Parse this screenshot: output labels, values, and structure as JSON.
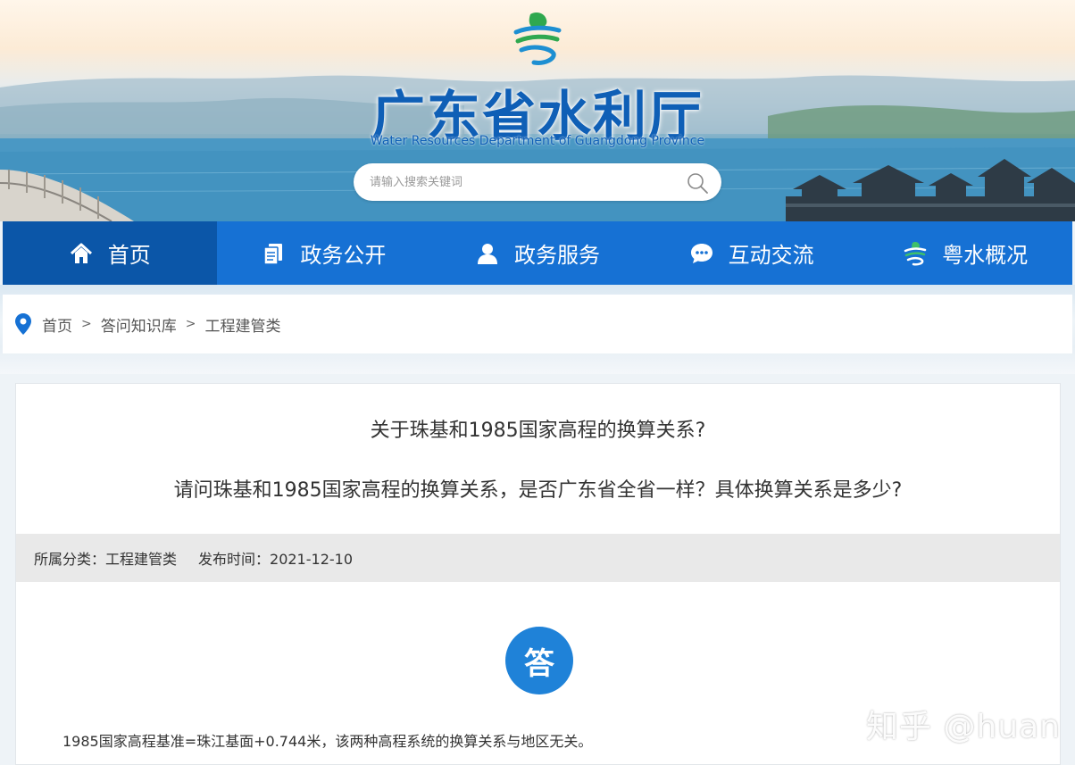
{
  "header": {
    "title": "广东省水利厅",
    "subtitle": "Water Resources Department of Guangdong Province",
    "logo_icon": "yue-emblem-icon",
    "search_placeholder": "请输入搜索关键词"
  },
  "nav": {
    "items": [
      {
        "label": "首页",
        "icon": "home-icon",
        "active": true
      },
      {
        "label": "政务公开",
        "icon": "document-icon",
        "active": false
      },
      {
        "label": "政务服务",
        "icon": "user-icon",
        "active": false
      },
      {
        "label": "互动交流",
        "icon": "chat-icon",
        "active": false
      },
      {
        "label": "粤水概况",
        "icon": "yue-emblem-icon",
        "active": false
      }
    ]
  },
  "breadcrumb": {
    "icon": "location-pin-icon",
    "items": [
      "首页",
      "答问知识库",
      "工程建管类"
    ],
    "separator": ">"
  },
  "question": {
    "title": "关于珠基和1985国家高程的换算关系?",
    "body": "请问珠基和1985国家高程的换算关系，是否广东省全省一样？具体换算关系是多少?"
  },
  "meta": {
    "category": "所属分类：工程建管类",
    "date": "发布时间：2021-12-10"
  },
  "answer": {
    "badge": "答",
    "text": "1985国家高程基准=珠江基面+0.744米，该两种高程系统的换算关系与地区无关。"
  },
  "watermark": "知乎 @huan",
  "colors": {
    "nav_blue": "#1671d4",
    "nav_active": "#0b56a8",
    "title_blue": "#0f5fb6",
    "answer_badge": "#1f82d8"
  }
}
